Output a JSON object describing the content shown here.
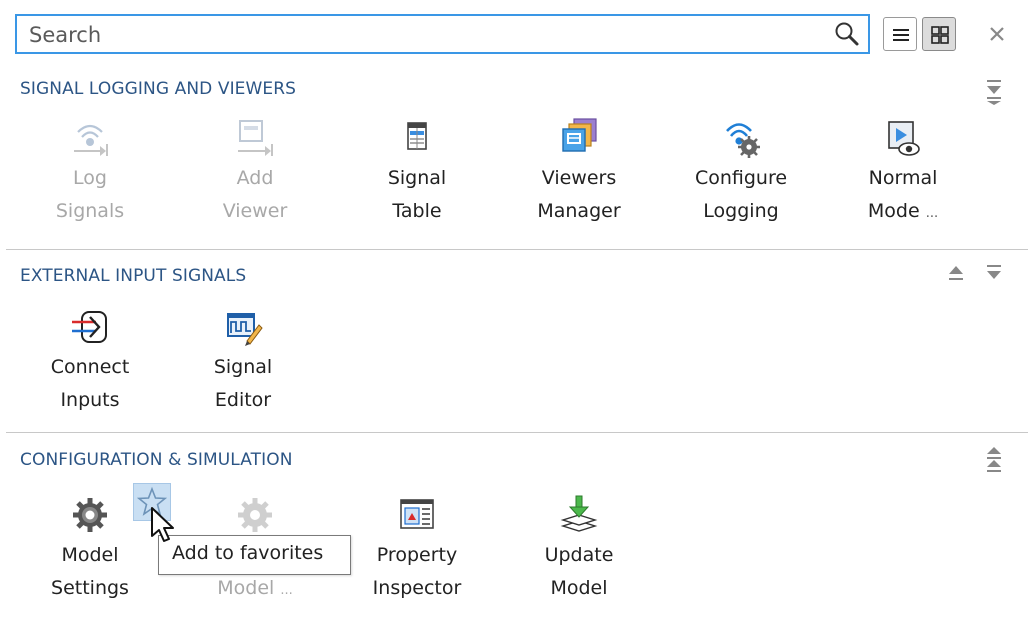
{
  "search": {
    "placeholder": "Search"
  },
  "view_buttons": [
    {
      "name": "list-view",
      "active": false
    },
    {
      "name": "tile-view",
      "active": true
    }
  ],
  "sections": [
    {
      "title": "SIGNAL LOGGING AND VIEWERS",
      "tiles": [
        {
          "line1": "Log",
          "line2": "Signals",
          "icon": "log-signals-icon",
          "enabled": false
        },
        {
          "line1": "Add",
          "line2": "Viewer",
          "icon": "add-viewer-icon",
          "enabled": false
        },
        {
          "line1": "Signal",
          "line2": "Table",
          "icon": "signal-table-icon",
          "enabled": true
        },
        {
          "line1": "Viewers",
          "line2": "Manager",
          "icon": "viewers-manager-icon",
          "enabled": true
        },
        {
          "line1": "Configure",
          "line2": "Logging",
          "icon": "configure-logging-icon",
          "enabled": true
        },
        {
          "line1": "Normal",
          "line2": "Mode",
          "icon": "normal-mode-icon",
          "enabled": true,
          "ellipsis": "..."
        }
      ]
    },
    {
      "title": "EXTERNAL INPUT SIGNALS",
      "tiles": [
        {
          "line1": "Connect",
          "line2": "Inputs",
          "icon": "connect-inputs-icon",
          "enabled": true
        },
        {
          "line1": "Signal",
          "line2": "Editor",
          "icon": "signal-editor-icon",
          "enabled": true
        }
      ]
    },
    {
      "title": "CONFIGURATION & SIMULATION",
      "tiles": [
        {
          "line1": "Model",
          "line2": "Settings",
          "icon": "model-settings-icon",
          "enabled": true
        },
        {
          "line1": "",
          "line2": "Model",
          "icon": "model-settings-disabled-icon",
          "enabled": false,
          "ellipsis": "..."
        },
        {
          "line1": "Property",
          "line2": "Inspector",
          "icon": "property-inspector-icon",
          "enabled": true
        },
        {
          "line1": "Update",
          "line2": "Model",
          "icon": "update-model-icon",
          "enabled": true
        }
      ]
    }
  ],
  "tooltip": {
    "text": "Add to favorites"
  },
  "colors": {
    "accent": "#3a97e6",
    "section_title": "#2c5585",
    "disabled_text": "#a8a8a8"
  }
}
